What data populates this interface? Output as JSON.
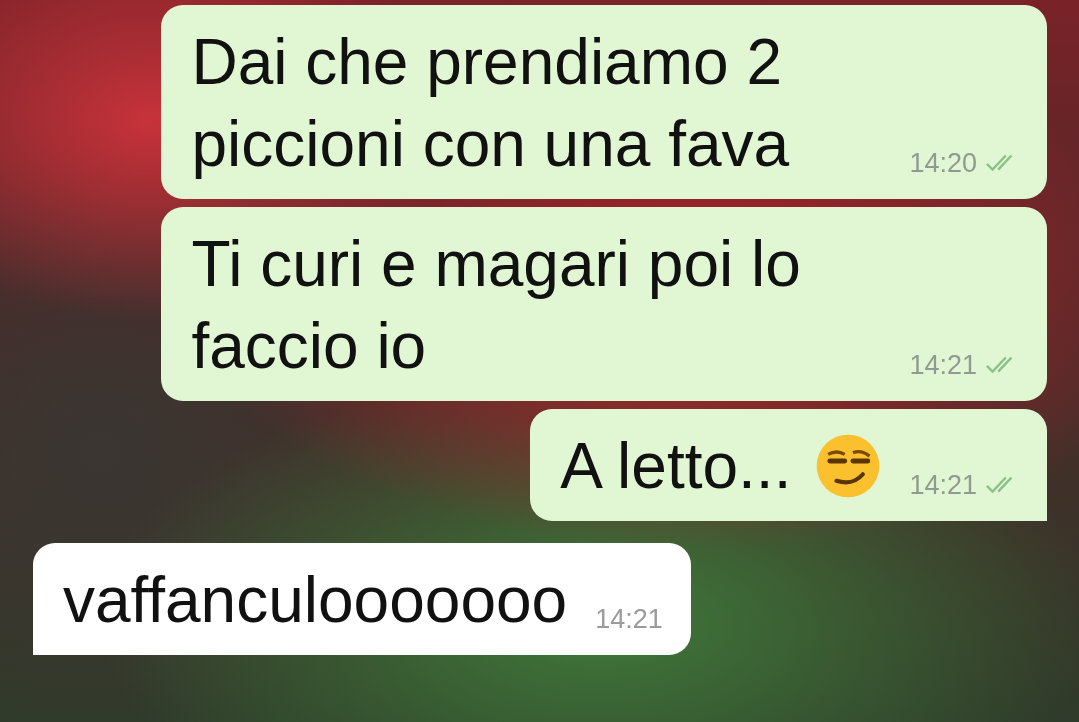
{
  "messages": [
    {
      "kind": "outgoing",
      "text": "Dai che prendiamo 2 piccioni con una fava",
      "time": "14:20",
      "read": false,
      "tail": false
    },
    {
      "kind": "outgoing",
      "text": "Ti curi e magari poi lo faccio io",
      "time": "14:21",
      "read": false,
      "tail": false
    },
    {
      "kind": "outgoing",
      "text": "A letto...",
      "has_emoji": true,
      "time": "14:21",
      "read": false,
      "tail": true
    },
    {
      "kind": "incoming",
      "text": "vaffanculooooooo",
      "time": "14:21",
      "tail": true
    }
  ]
}
